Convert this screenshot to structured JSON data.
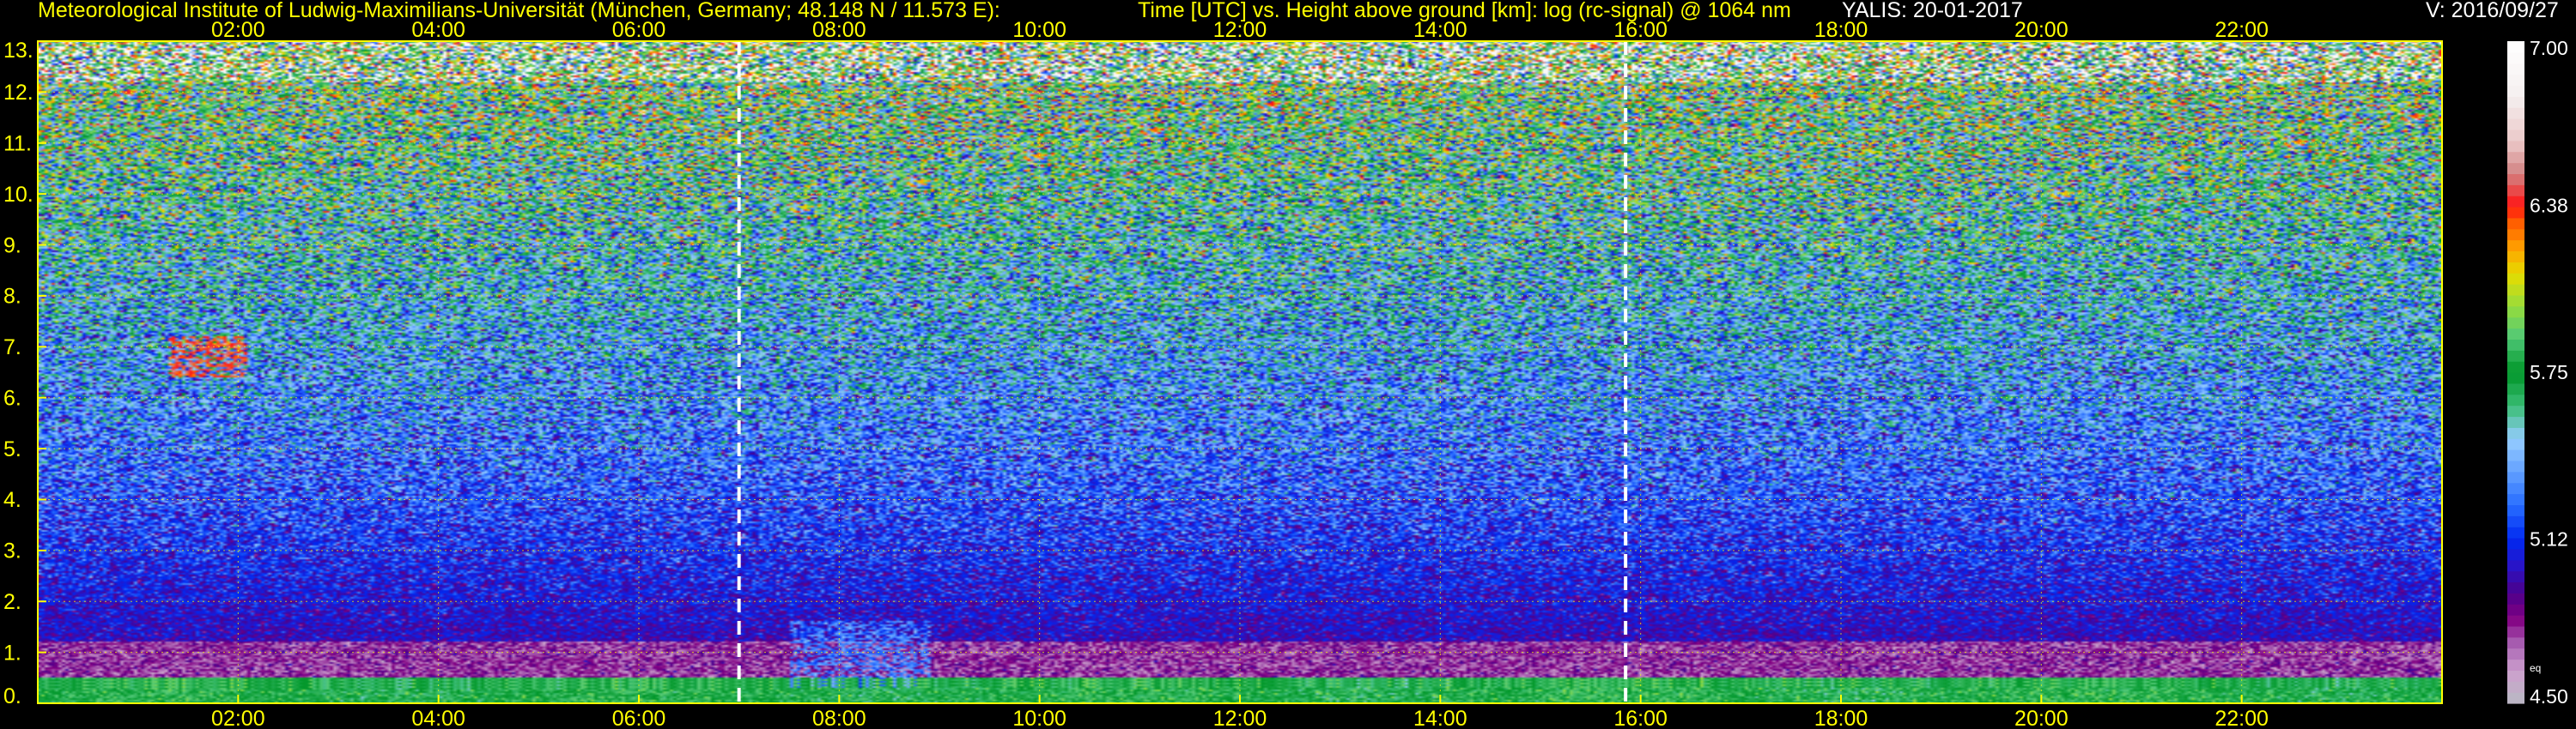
{
  "header": {
    "institute": "Meteorological Institute of Ludwig-Maximilians-Universität (München, Germany; 48.148 N / 11.573 E):",
    "title": "Time [UTC] vs. Height above ground [km]: log (rc-signal) @ 1064 nm",
    "instrument_date": "YALIS: 20-01-2017",
    "version": "V: 2016/09/27"
  },
  "chart_data": {
    "type": "heatmap",
    "title": "Time [UTC] vs. Height above ground [km]: log (rc-signal) @ 1064 nm",
    "xlabel": "Time [UTC]",
    "ylabel": "Height above ground [km]",
    "xlim": [
      0,
      24
    ],
    "ylim": [
      0,
      13
    ],
    "x_ticks": [
      "02:00",
      "04:00",
      "06:00",
      "08:00",
      "10:00",
      "12:00",
      "14:00",
      "16:00",
      "18:00",
      "20:00",
      "22:00"
    ],
    "x_tick_hours": [
      2,
      4,
      6,
      8,
      10,
      12,
      14,
      16,
      18,
      20,
      22
    ],
    "top_x_ticks": [
      "02:00",
      "04:00",
      "06:00",
      "08:00",
      "10:00",
      "12:00",
      "14:00",
      "16:00",
      "18:00",
      "20:00",
      "22:00"
    ],
    "y_ticks": [
      "0.",
      "1.",
      "2.",
      "3.",
      "4.",
      "5.",
      "6.",
      "7.",
      "8.",
      "9.",
      "10.",
      "11.",
      "12.",
      "13."
    ],
    "y_tick_values": [
      0,
      1,
      2,
      3,
      4,
      5,
      6,
      7,
      8,
      9,
      10,
      11,
      12,
      13
    ],
    "grid": true,
    "dashed_vertical_markers_hours": [
      7.0,
      15.85
    ],
    "colorbar": {
      "min": 4.5,
      "max": 7.0,
      "labels": [
        "7.00",
        "6.38",
        "5.75",
        "5.12",
        "4.50"
      ],
      "label_values": [
        7.0,
        6.38,
        5.75,
        5.12,
        4.5
      ],
      "small_label": "eq"
    },
    "features": [
      {
        "name": "elevated aerosol/cloud patch",
        "time_hours": [
          1.3,
          2.1
        ],
        "height_km": [
          6.4,
          7.2
        ],
        "value_approx": 6.4
      },
      {
        "name": "low clouds",
        "time_hours": [
          7.5,
          8.9
        ],
        "height_km": [
          0.3,
          1.6
        ],
        "value_approx": 5.3
      },
      {
        "name": "boundary layer",
        "time_hours": [
          0,
          24
        ],
        "height_km": [
          0.0,
          0.5
        ],
        "value_approx": 5.8
      }
    ]
  }
}
